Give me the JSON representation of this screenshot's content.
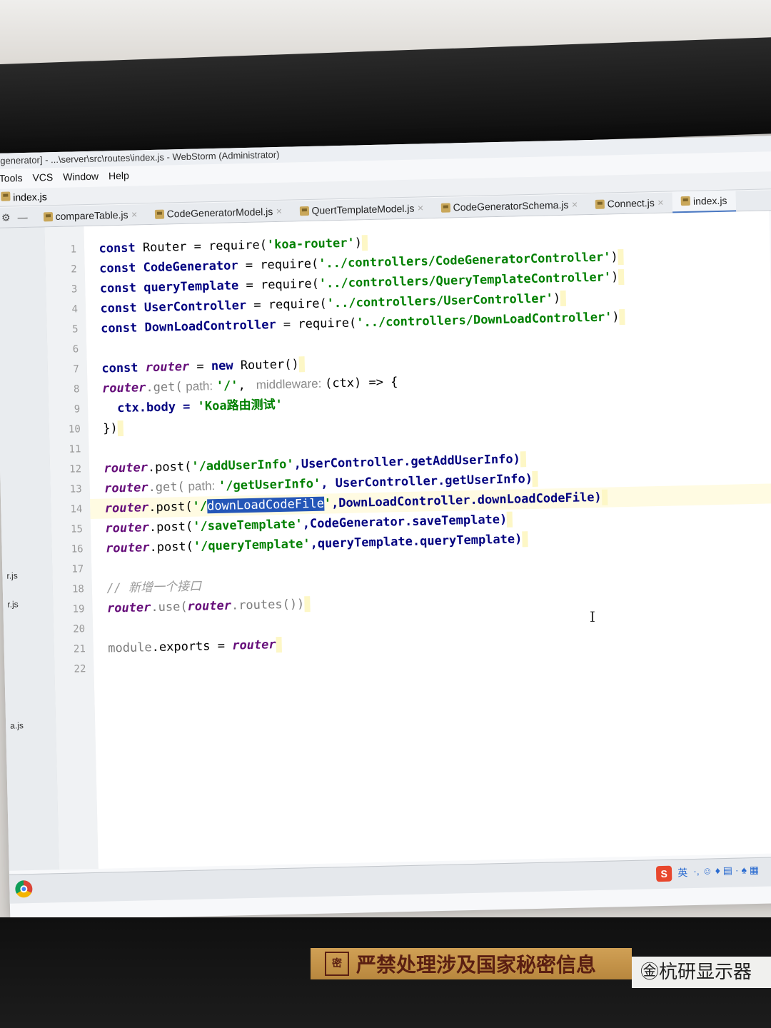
{
  "window": {
    "title": "generator] - ...\\server\\src\\routes\\index.js - WebStorm (Administrator)"
  },
  "menu": [
    "Tools",
    "VCS",
    "Window",
    "Help"
  ],
  "breadcrumb": "index.js",
  "tabs": [
    {
      "label": "compareTable.js",
      "active": false
    },
    {
      "label": "CodeGeneratorModel.js",
      "active": false
    },
    {
      "label": "QuertTemplateModel.js",
      "active": false
    },
    {
      "label": "CodeGeneratorSchema.js",
      "active": false
    },
    {
      "label": "Connect.js",
      "active": false
    },
    {
      "label": "index.js",
      "active": true
    }
  ],
  "left_panel_files": [
    "r.js",
    "r.js",
    "a.js"
  ],
  "code": {
    "line_numbers": [
      "1",
      "2",
      "3",
      "4",
      "5",
      "6",
      "7",
      "8",
      "9",
      "10",
      "11",
      "12",
      "13",
      "14",
      "15",
      "16",
      "17",
      "18",
      "19",
      "20",
      "21",
      "22"
    ],
    "current_line": 14,
    "l1": {
      "kw": "const",
      "name": " Router",
      "eq": " = ",
      "fn": "require(",
      "str": "'koa-router'",
      "end": ")"
    },
    "l2": {
      "kw": "const",
      "name": " CodeGenerator",
      "eq": " = ",
      "fn": "require(",
      "str": "'../controllers/CodeGeneratorController'",
      "end": ")"
    },
    "l3": {
      "kw": "const",
      "name": " queryTemplate",
      "eq": " = ",
      "fn": "require(",
      "str": "'../controllers/QueryTemplateController'",
      "end": ")"
    },
    "l4": {
      "kw": "const",
      "name": " UserController",
      "eq": " = ",
      "fn": "require(",
      "str": "'../controllers/UserController'",
      "end": ")"
    },
    "l5": {
      "kw": "const",
      "name": " DownLoadController",
      "eq": " = ",
      "fn": "require(",
      "str": "'../controllers/DownLoadController'",
      "end": ")"
    },
    "l7": {
      "kw": "const",
      "var": " router",
      "eq": " = ",
      "kw2": "new",
      "rest": " Router()"
    },
    "l8": {
      "var": "router",
      "fn": ".get(",
      "hint1": " path: ",
      "str": "'/'",
      "comma": ", ",
      "hint2": " middleware: ",
      "rest": "(ctx) => {"
    },
    "l9": {
      "rest": "ctx.body = ",
      "str": "'Koa路由测试'"
    },
    "l10": {
      "rest": "})"
    },
    "l12": {
      "var": "router",
      "fn": ".post(",
      "str": "'/addUserInfo'",
      "rest": ",UserController.getAddUserInfo)"
    },
    "l13": {
      "var": "router",
      "fn": ".get(",
      "hint": " path: ",
      "str": "'/getUserInfo'",
      "rest": ", UserController.getUserInfo)"
    },
    "l14": {
      "var": "router",
      "fn": ".post(",
      "str1": "'/",
      "sel": "downLoadCodeFile",
      "str2": "'",
      "rest": ",DownLoadController.downLoadCodeFile)"
    },
    "l15": {
      "var": "router",
      "fn": ".post(",
      "str": "'/saveTemplate'",
      "rest": ",CodeGenerator.saveTemplate)"
    },
    "l16": {
      "var": "router",
      "fn": ".post(",
      "str": "'/queryTemplate'",
      "rest": ",queryTemplate.queryTemplate)"
    },
    "l18": {
      "comment": "// 新增一个接口"
    },
    "l19": {
      "var": "router",
      "fn": ".use(",
      "var2": "router",
      "rest": ".routes())"
    },
    "l21": {
      "dim": "module",
      "rest": ".exports = ",
      "var": "router"
    }
  },
  "status": {
    "ime_logo": "S",
    "ime_lang": "英",
    "ime_icons": "·, ☺ ♦ ▤ · ♠ ▦"
  },
  "monitor": {
    "sticker_seal": "密",
    "sticker_text": "严禁处理涉及国家秘密信息",
    "brand": "㊎杭研显示器"
  }
}
